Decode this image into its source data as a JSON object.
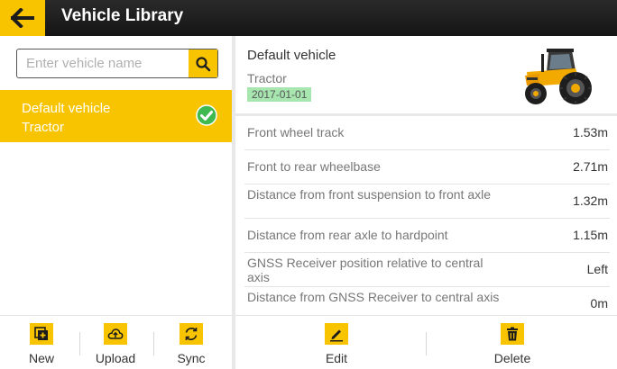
{
  "header": {
    "title": "Vehicle Library"
  },
  "search": {
    "placeholder": "Enter vehicle name",
    "value": ""
  },
  "vehicles": [
    {
      "name": "Default vehicle",
      "type": "Tractor",
      "selected": true
    }
  ],
  "left_toolbar": {
    "new_label": "New",
    "upload_label": "Upload",
    "sync_label": "Sync"
  },
  "detail": {
    "name": "Default vehicle",
    "type": "Tractor",
    "date": "2017-01-01",
    "specs": [
      {
        "label": "Front wheel track",
        "value": "1.53m"
      },
      {
        "label": "Front to rear wheelbase",
        "value": "2.71m"
      },
      {
        "label": "Distance from front suspension to front axle",
        "value": "1.32m"
      },
      {
        "label": "Distance from rear axle to hardpoint",
        "value": "1.15m"
      },
      {
        "label": "GNSS Receiver position relative to central axis",
        "value": "Left"
      },
      {
        "label": "Distance from GNSS Receiver to central axis",
        "value": "0m"
      }
    ]
  },
  "right_toolbar": {
    "edit_label": "Edit",
    "delete_label": "Delete"
  },
  "colors": {
    "accent": "#f8c400",
    "header_bg": "#1c1c1c",
    "date_badge": "#a8e6b0",
    "check": "#3fb950"
  }
}
